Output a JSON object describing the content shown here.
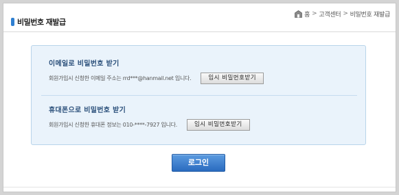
{
  "header": {
    "title": "비밀번호 재발급",
    "breadcrumb": {
      "home": "홈",
      "sep1": ">",
      "item1": "고객센터",
      "sep2": ">",
      "current": "비밀번호 재발급",
      "home_icon": "home-icon"
    }
  },
  "email_section": {
    "title": "이메일로 비밀번호 받기",
    "description": "회원가입시 신청한 이메일 주소는 rrd***@hanmail.net 입니다.",
    "button_label": "임시 비밀번호받기"
  },
  "phone_section": {
    "title": "휴대폰으로 비밀번호 받기",
    "description": "회원가입시 신청한 휴대폰 정보는 010-****-7927 입니다.",
    "button_label": "임시 비밀번호받기"
  },
  "login_button": {
    "label": "로그인"
  },
  "colors": {
    "accent": "#2f7fd1",
    "box_background": "#eaf3fb",
    "box_border": "#b8d4ea",
    "section_title": "#2a4f7a",
    "login_button": "#3a7dd0"
  }
}
